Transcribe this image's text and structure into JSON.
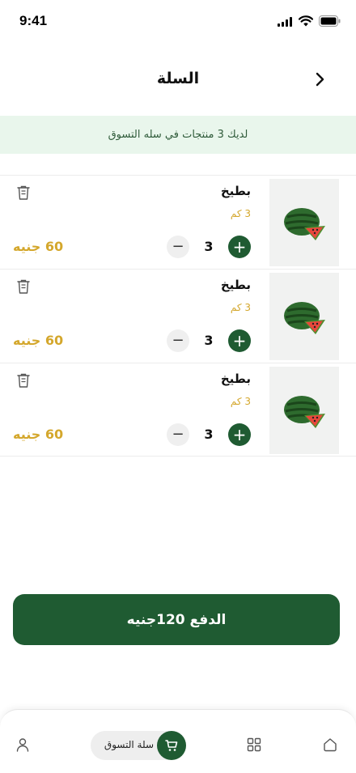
{
  "status_bar": {
    "time": "9:41"
  },
  "header": {
    "title": "السلة",
    "back_icon": "chevron-right-icon"
  },
  "banner": {
    "text": "لديك 3 منتجات في سله التسوق"
  },
  "cart": {
    "items": [
      {
        "name": "بطيخ",
        "weight": "3 كم",
        "quantity": "3",
        "price": "60 جنيه",
        "plus": "+",
        "minus": "−"
      },
      {
        "name": "بطيخ",
        "weight": "3 كم",
        "quantity": "3",
        "price": "60 جنيه",
        "plus": "+",
        "minus": "−"
      },
      {
        "name": "بطيخ",
        "weight": "3 كم",
        "quantity": "3",
        "price": "60 جنيه",
        "plus": "+",
        "minus": "−"
      }
    ]
  },
  "checkout": {
    "label": "الدفع  120جنيه"
  },
  "bottom_nav": {
    "cart_label": "سلة التسوق",
    "items": [
      "home-icon",
      "grid-icon",
      "cart-icon",
      "profile-icon"
    ]
  },
  "colors": {
    "primary": "#1f5b32",
    "accent": "#d4a72c",
    "banner_bg": "#e9f6ec"
  }
}
